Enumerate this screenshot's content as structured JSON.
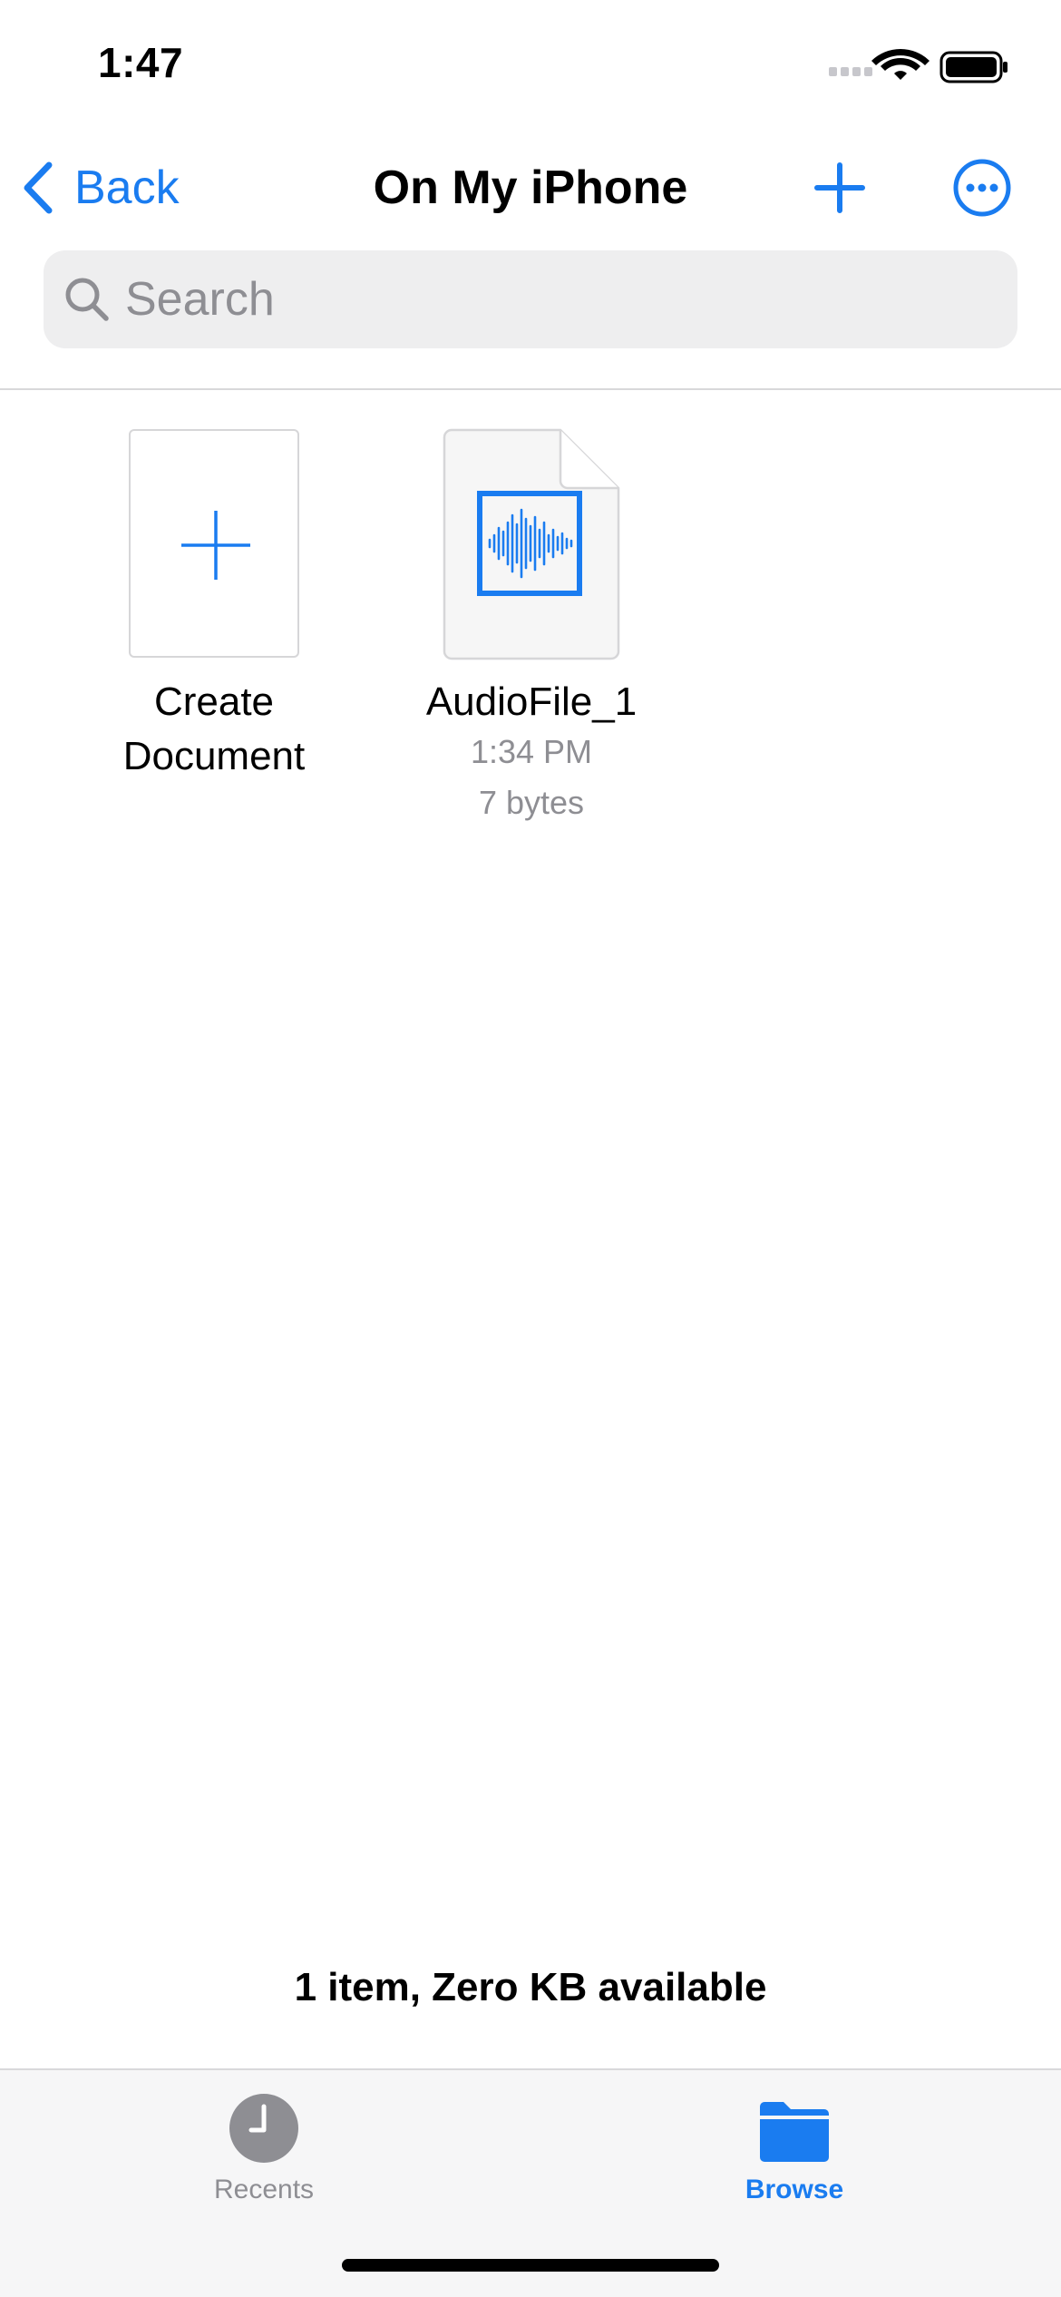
{
  "status_bar": {
    "time": "1:47",
    "icons": [
      "cellular-signal-icon",
      "wifi-icon",
      "battery-icon"
    ]
  },
  "nav": {
    "back_label": "Back",
    "title": "On My iPhone",
    "add_icon": "plus-icon",
    "more_icon": "ellipsis-circle-icon"
  },
  "search": {
    "placeholder": "Search",
    "value": ""
  },
  "items": [
    {
      "kind": "create",
      "label": "Create Document",
      "icon": "plus-icon"
    },
    {
      "kind": "file",
      "name": "AudioFile_1",
      "modified": "1:34 PM",
      "size": "7 bytes",
      "icon": "audio-waveform-icon"
    }
  ],
  "summary": "1 item, Zero KB available",
  "tabbar": {
    "tabs": [
      {
        "label": "Recents",
        "icon": "clock-icon",
        "active": false
      },
      {
        "label": "Browse",
        "icon": "folder-icon",
        "active": true
      }
    ]
  },
  "colors": {
    "accent": "#1a7cf0",
    "secondary_text": "#8e8e93",
    "search_background": "#eeeeef",
    "tabbar_background": "#f6f6f7"
  }
}
